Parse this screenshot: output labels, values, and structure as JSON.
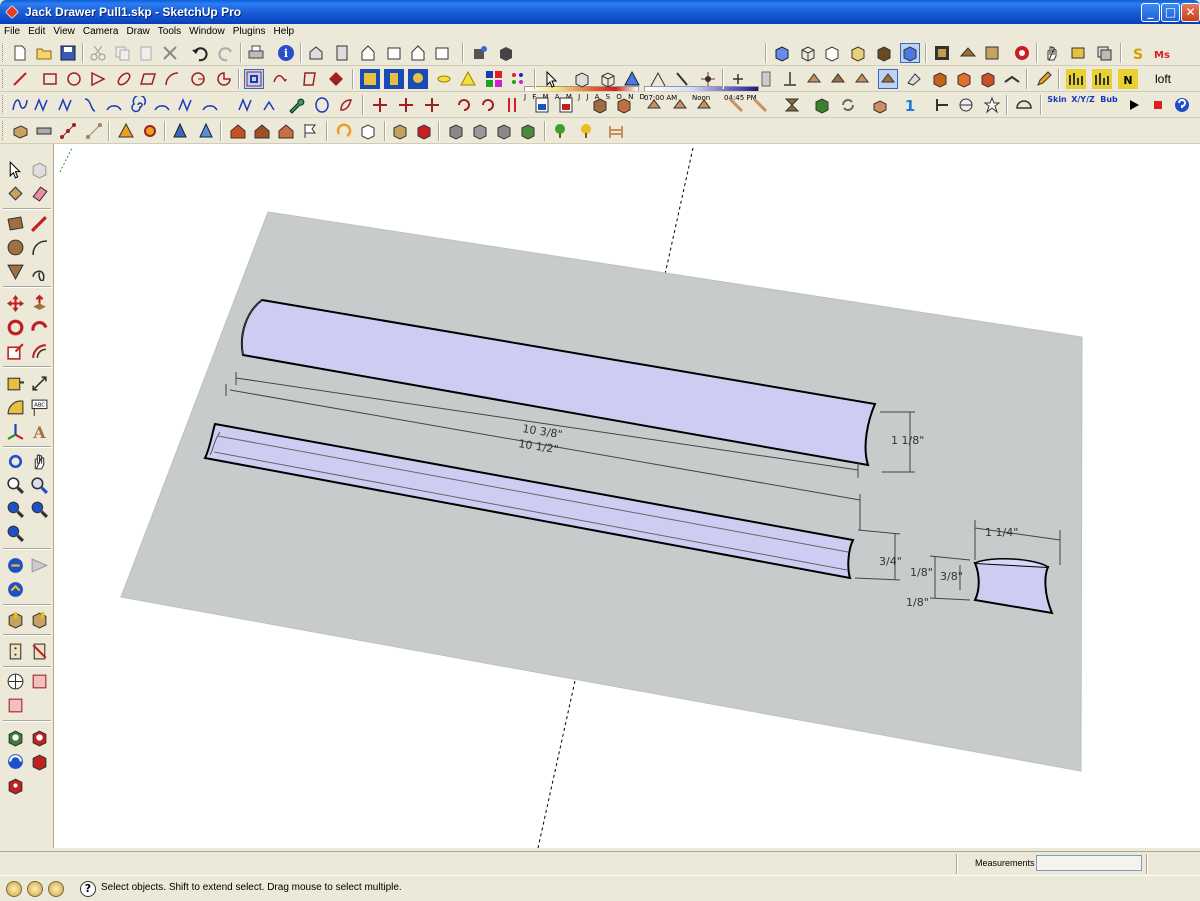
{
  "window": {
    "title": "Jack Drawer Pull1.skp - SketchUp Pro",
    "min_label": "_",
    "max_label": "□",
    "close_label": "✕"
  },
  "menu": [
    "File",
    "Edit",
    "View",
    "Camera",
    "Draw",
    "Tools",
    "Window",
    "Plugins",
    "Help"
  ],
  "shadow_settings": {
    "months": "J F M A M J J A S O N D",
    "time_start": "07:00 AM",
    "time_noon": "Noon",
    "time_end": "04:45 PM"
  },
  "toolbar_text": {
    "loft": "loft",
    "skin": "Skin",
    "xyz": "X/Y/Z",
    "bub": "Bub"
  },
  "model": {
    "dim_length_inner": "10 3/8\"",
    "dim_length_outer": "10 1/2\"",
    "dim_height": "1 1/8\"",
    "dim_depth": "3/4\"",
    "dim_width_end": "1 1/4\"",
    "dim_top": "1/8\"",
    "dim_middle": "3/8\"",
    "dim_bottom": "1/8\""
  },
  "measurements": {
    "label": "Measurements",
    "value": ""
  },
  "status": {
    "help": "?",
    "text": "Select objects. Shift to extend select. Drag mouse to select multiple."
  }
}
